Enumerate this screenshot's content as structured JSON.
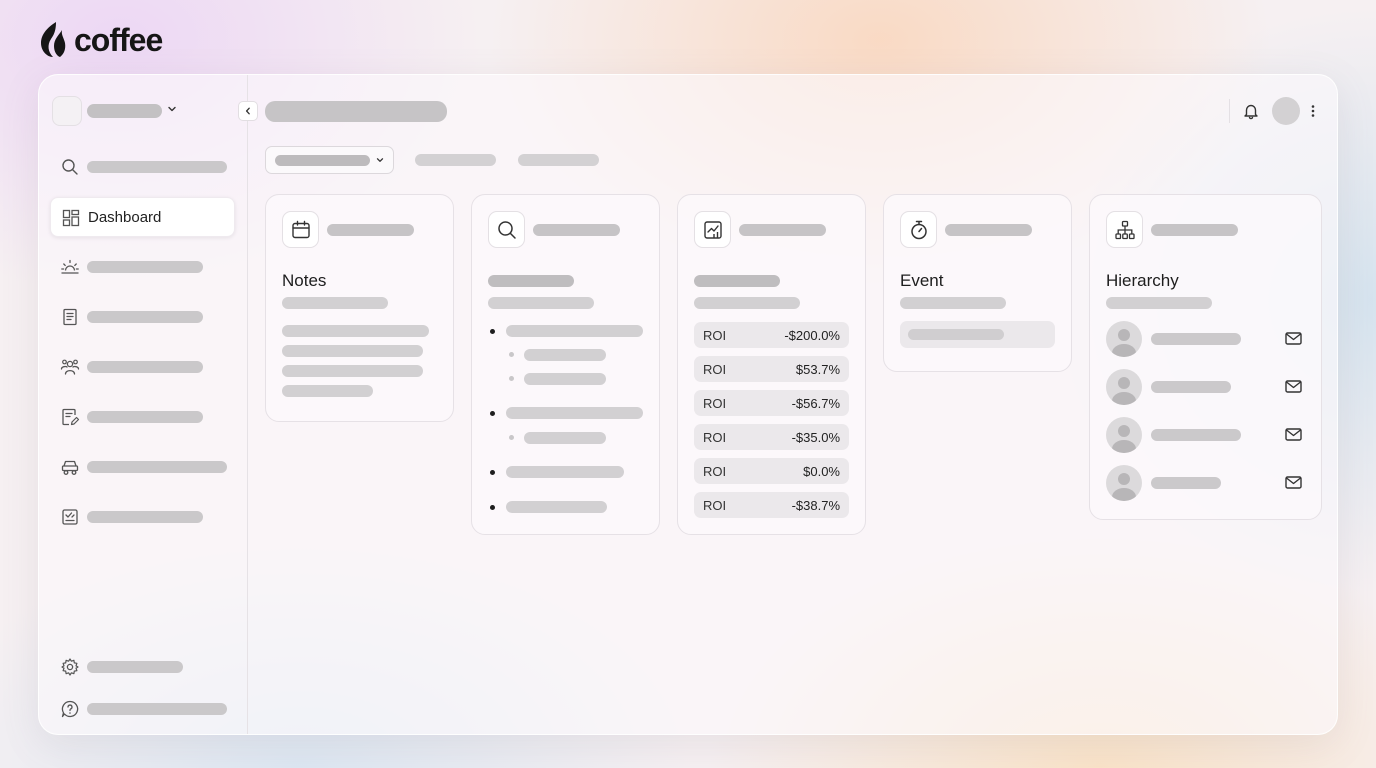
{
  "brand": {
    "name": "coffee",
    "logo_icon": "coffee-flame-icon"
  },
  "sidebar": {
    "workspace_icon": "chevron-down-icon",
    "nav": [
      {
        "icon": "search-icon",
        "label": ""
      },
      {
        "icon": "dashboard-icon",
        "label": "Dashboard",
        "active": true
      },
      {
        "icon": "sunrise-icon",
        "label": ""
      },
      {
        "icon": "document-icon",
        "label": ""
      },
      {
        "icon": "team-icon",
        "label": ""
      },
      {
        "icon": "edit-document-icon",
        "label": ""
      },
      {
        "icon": "vehicle-icon",
        "label": ""
      },
      {
        "icon": "checklist-icon",
        "label": ""
      }
    ],
    "footer": [
      {
        "icon": "gear-icon",
        "label": ""
      },
      {
        "icon": "help-icon",
        "label": ""
      }
    ]
  },
  "header": {
    "collapse_icon": "chevron-left-icon",
    "notification_icon": "bell-icon",
    "menu_icon": "more-vertical-icon"
  },
  "cards": {
    "notes": {
      "icon": "calendar-icon",
      "title": "Notes"
    },
    "search": {
      "icon": "search-icon"
    },
    "roi": {
      "icon": "chart-icon",
      "rows": [
        {
          "label": "ROI",
          "value": "-$200.0%"
        },
        {
          "label": "ROI",
          "value": "$53.7%"
        },
        {
          "label": "ROI",
          "value": "-$56.7%"
        },
        {
          "label": "ROI",
          "value": "-$35.0%"
        },
        {
          "label": "ROI",
          "value": "$0.0%"
        },
        {
          "label": "ROI",
          "value": "-$38.7%"
        }
      ]
    },
    "event": {
      "icon": "timer-icon",
      "title": "Event"
    },
    "hierarchy": {
      "icon": "org-chart-icon",
      "title": "Hierarchy",
      "row_icon": "mail-icon"
    }
  },
  "colors": {
    "background": "#f6f0f2",
    "skeleton": "#c9c7c9",
    "active_nav": "#ffffff"
  }
}
